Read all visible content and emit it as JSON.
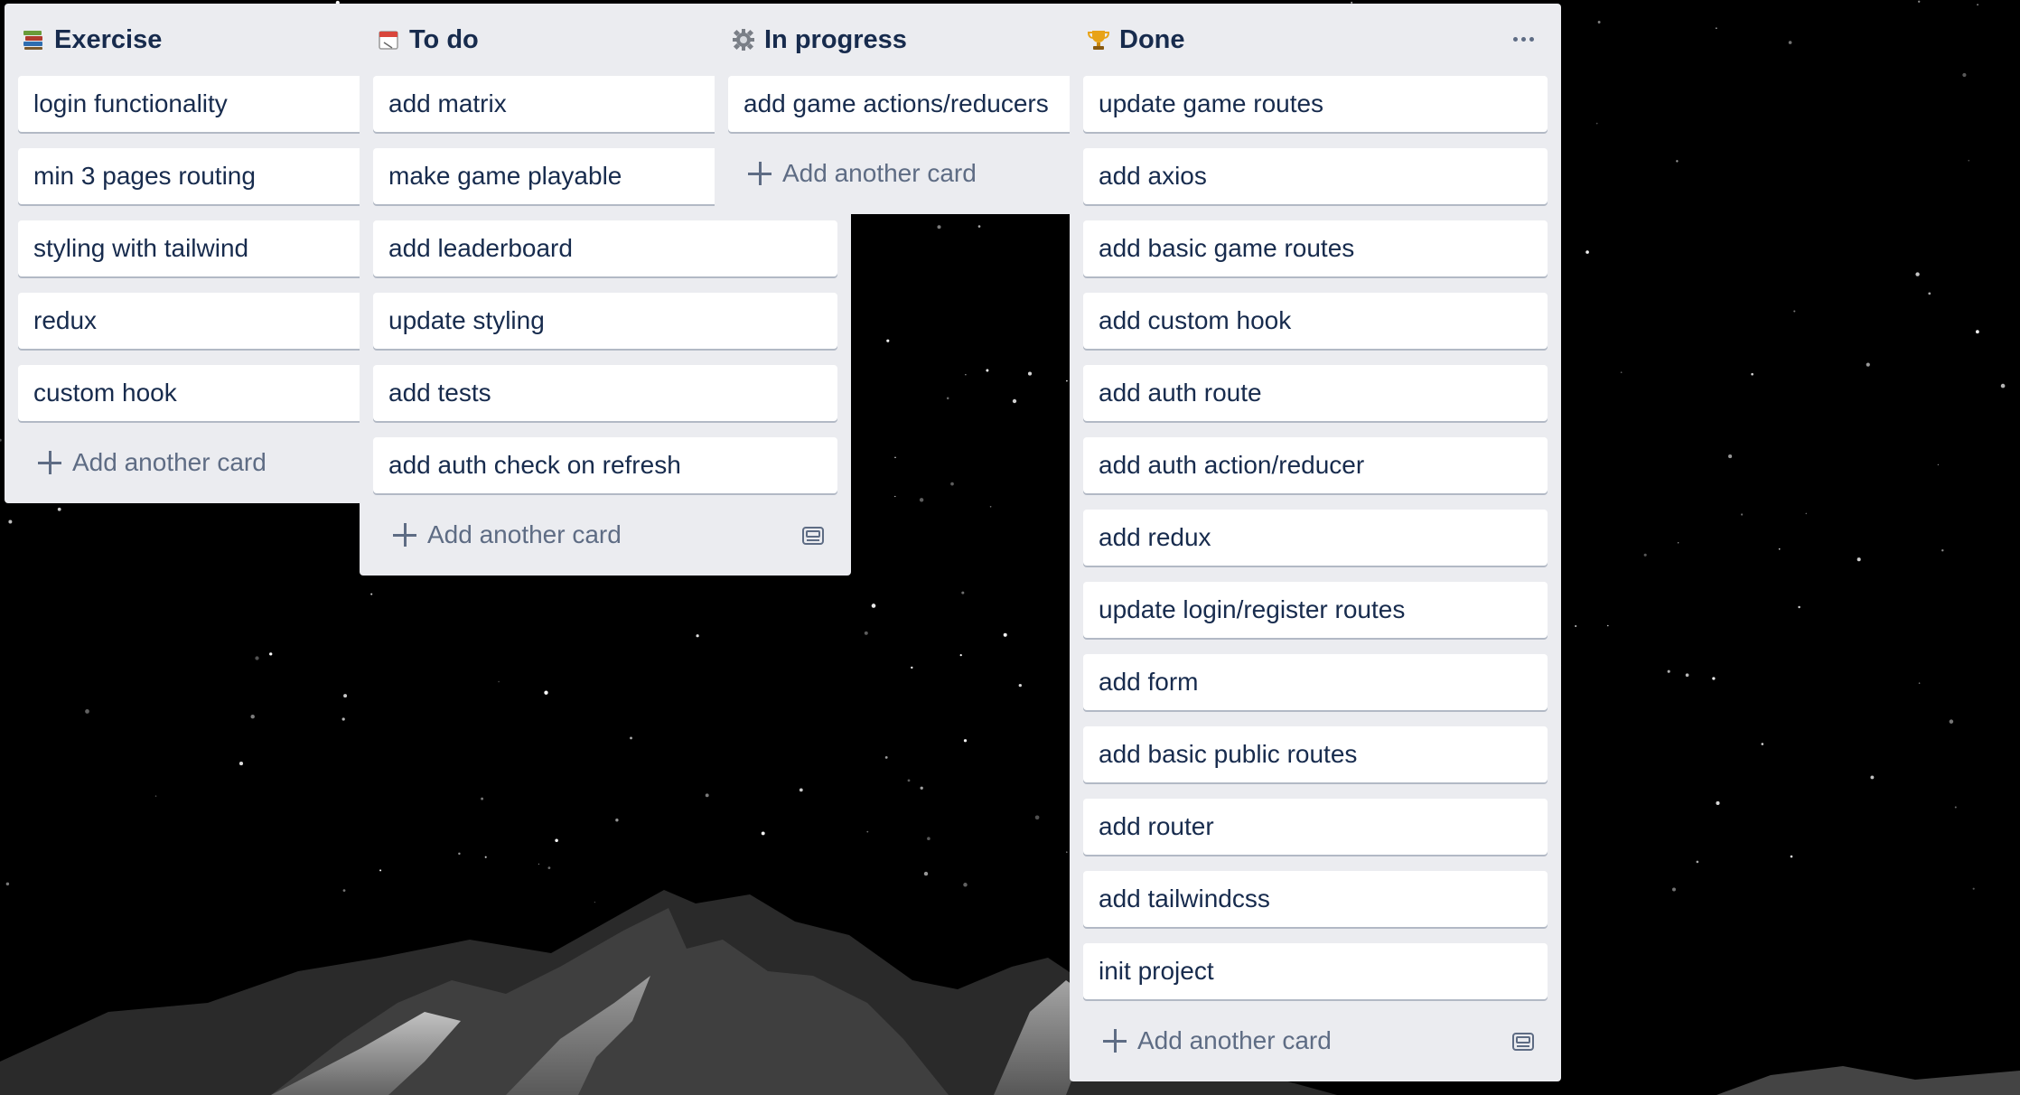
{
  "colors": {
    "list_bg": "#ebecf0",
    "card_bg": "#ffffff",
    "text": "#172b4d",
    "muted": "#5e6c84",
    "background": "#000000"
  },
  "add_card_label": "Add another card",
  "lists": [
    {
      "title": "Exercise",
      "icon": "books-icon",
      "cards": [
        "login functionality",
        "min 3 pages routing",
        "styling with tailwind",
        "redux",
        "custom hook"
      ]
    },
    {
      "title": "To do",
      "icon": "calendar-icon",
      "cards": [
        "add matrix",
        "make game playable",
        "add leaderboard",
        "update styling",
        "add tests",
        "add auth check on refresh"
      ]
    },
    {
      "title": "In progress",
      "icon": "gear-icon",
      "cards": [
        "add game actions/reducers"
      ]
    },
    {
      "title": "Done",
      "icon": "trophy-icon",
      "cards": [
        "update game routes",
        "add axios",
        "add basic game routes",
        "add custom hook",
        "add auth route",
        "add auth action/reducer",
        "add redux",
        "update login/register routes",
        "add form",
        "add basic public routes",
        "add router",
        "add tailwindcss",
        "init project"
      ]
    }
  ]
}
